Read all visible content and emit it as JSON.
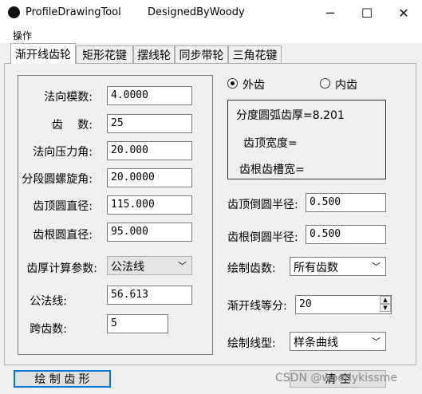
{
  "window": {
    "app_title": "ProfileDrawingTool",
    "author_title": "DesignedByWoody",
    "minimize_glyph": "─",
    "maximize_glyph": "☐",
    "close_glyph": "✕"
  },
  "menu": {
    "operations": "操作"
  },
  "tabs": [
    "渐开线齿轮",
    "矩形花键",
    "摆线轮",
    "同步带轮",
    "三角花键"
  ],
  "left_group": {
    "normal_module_label": "法向模数:",
    "normal_module_value": "4.0000",
    "teeth_label": "齿　 数:",
    "teeth_value": "25",
    "pressure_angle_label": "法向压力角:",
    "pressure_angle_value": "20.000",
    "helix_angle_label": "分段圆螺旋角:",
    "helix_angle_value": "20.0000",
    "tip_diameter_label": "齿顶圆直径:",
    "tip_diameter_value": "115.000",
    "root_diameter_label": "齿根圆直径:",
    "root_diameter_value": "95.000",
    "thickness_param_label": "齿厚计算参数:",
    "thickness_param_value": "公法线",
    "common_normal_label": "公法线:",
    "common_normal_value": "56.613",
    "span_teeth_label": "跨齿数:",
    "span_teeth_value": "5"
  },
  "right": {
    "external_label": "外齿",
    "internal_label": "内齿",
    "info_line1": "分度圆弧齿厚=8.201",
    "info_line2": "齿顶宽度=",
    "info_line3": "齿根齿槽宽=",
    "tip_fillet_label": "齿顶倒圆半径:",
    "tip_fillet_value": "0.500",
    "root_fillet_label": "齿根倒圆半径:",
    "root_fillet_value": "0.500",
    "draw_teeth_label": "绘制齿数:",
    "draw_teeth_value": "所有齿数",
    "involute_div_label": "渐开线等分:",
    "involute_div_value": "20",
    "line_type_label": "绘制线型:",
    "line_type_value": "样条曲线"
  },
  "buttons": {
    "draw_profile": "绘 制 齿 形",
    "clear": "清 空"
  },
  "watermark": "CSDN @woodykissme"
}
